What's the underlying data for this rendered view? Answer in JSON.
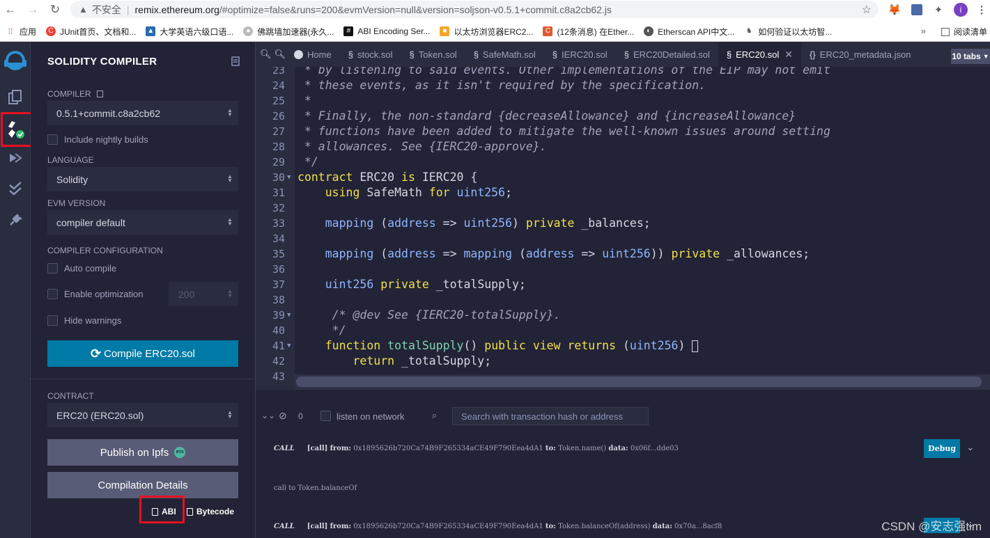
{
  "browser": {
    "insecure_label": "不安全",
    "url_host": "remix.ethereum.org",
    "url_path": "/#optimize=false&runs=200&evmVersion=null&version=soljson-v0.5.1+commit.c8a2cb62.js",
    "profile_initial": "i",
    "bookmarks": [
      {
        "label": "应用",
        "color": "#e8453c"
      },
      {
        "label": "JUnit首页、文档和...",
        "color": "#ea4335"
      },
      {
        "label": "大学英语六级口语...",
        "color": "#2b6cb0"
      },
      {
        "label": "佛跳墙加速器(永久...",
        "color": "#999999"
      },
      {
        "label": "ABI Encoding Ser...",
        "color": "#111111"
      },
      {
        "label": "以太坊浏览器ERC2...",
        "color": "#f5a623"
      },
      {
        "label": "(12条消息) 在Ether...",
        "color": "#e4572e"
      },
      {
        "label": "Etherscan API中文...",
        "color": "#555555"
      },
      {
        "label": "如何验证以太坊智...",
        "color": "#777777"
      }
    ],
    "bookmarks_more": "»",
    "reading_list": "阅读清单"
  },
  "sidebar": {
    "title": "SOLIDITY COMPILER",
    "compiler_label": "COMPILER",
    "compiler_value": "0.5.1+commit.c8a2cb62",
    "nightly_label": "Include nightly builds",
    "language_label": "LANGUAGE",
    "language_value": "Solidity",
    "evm_label": "EVM VERSION",
    "evm_value": "compiler default",
    "config_label": "COMPILER CONFIGURATION",
    "auto_compile": "Auto compile",
    "enable_opt": "Enable optimization",
    "runs_value": "200",
    "hide_warnings": "Hide warnings",
    "compile_button": "Compile ERC20.sol",
    "contract_label": "CONTRACT",
    "contract_value": "ERC20 (ERC20.sol)",
    "publish_button": "Publish on Ipfs",
    "ipfs_badge": "IPFS",
    "details_button": "Compilation Details",
    "abi_link": "ABI",
    "bytecode_link": "Bytecode"
  },
  "tabs": {
    "items": [
      "Home",
      "stock.sol",
      "Token.sol",
      "SafeMath.sol",
      "IERC20.sol",
      "ERC20Detailed.sol",
      "ERC20.sol",
      "ERC20_metadata.json"
    ],
    "count": "10 tabs"
  },
  "editor": {
    "lines": [
      {
        "n": "23",
        "text": " * by listening to said events. Other implementations of the EIP may not emit"
      },
      {
        "n": "24",
        "text": " * these events, as it isn't required by the specification."
      },
      {
        "n": "25",
        "text": " *"
      },
      {
        "n": "26",
        "text": " * Finally, the non-standard {decreaseAllowance} and {increaseAllowance}"
      },
      {
        "n": "27",
        "text": " * functions have been added to mitigate the well-known issues around setting"
      },
      {
        "n": "28",
        "text": " * allowances. See {IERC20-approve}."
      },
      {
        "n": "29",
        "text": " */"
      },
      {
        "n": "30",
        "text": "contract ERC20 is IERC20 {"
      },
      {
        "n": "31",
        "text": "    using SafeMath for uint256;"
      },
      {
        "n": "32",
        "text": ""
      },
      {
        "n": "33",
        "text": "    mapping (address => uint256) private _balances;"
      },
      {
        "n": "34",
        "text": ""
      },
      {
        "n": "35",
        "text": "    mapping (address => mapping (address => uint256)) private _allowances;"
      },
      {
        "n": "36",
        "text": ""
      },
      {
        "n": "37",
        "text": "    uint256 private _totalSupply;"
      },
      {
        "n": "38",
        "text": ""
      },
      {
        "n": "39",
        "text": "     /* @dev See {IERC20-totalSupply}."
      },
      {
        "n": "40",
        "text": "     */"
      },
      {
        "n": "41",
        "text": "    function totalSupply() public view returns (uint256) {"
      },
      {
        "n": "42",
        "text": "        return _totalSupply;"
      },
      {
        "n": "43",
        "text": ""
      }
    ]
  },
  "terminal": {
    "count": "0",
    "listen_label": "listen on network",
    "search_placeholder": "Search with transaction hash or address",
    "debug_button": "Debug",
    "rows": [
      {
        "kind": "CALL",
        "tag": "[call]",
        "from_label": "from:",
        "from": "0x1895626b720Ca74B9F265334aCE49F790Eea4dA1",
        "to_label": "to:",
        "to": "Token.name()",
        "data_label": "data:",
        "data": "0x06f...dde03"
      },
      {
        "note": "call to Token.balanceOf"
      },
      {
        "kind": "CALL",
        "tag": "[call]",
        "from_label": "from:",
        "from": "0x1895626b720Ca74B9F265334aCE49F790Eea4dA1",
        "to_label": "to:",
        "to": "Token.balanceOf(address)",
        "data_label": "data:",
        "data": "0x70a...8acf8"
      }
    ]
  },
  "watermark": "CSDN @安志强tim"
}
